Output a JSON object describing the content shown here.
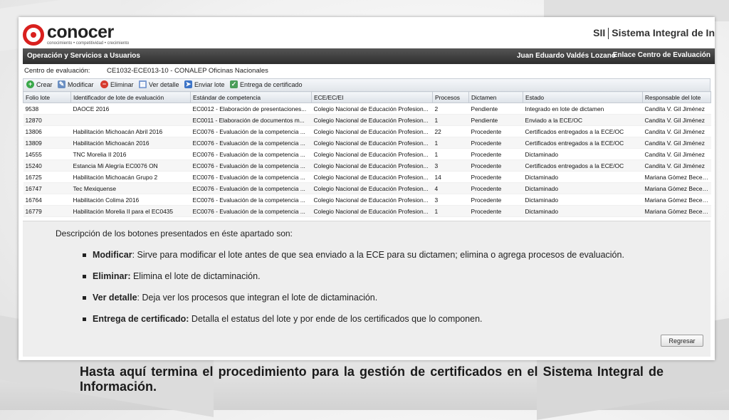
{
  "brand": {
    "name": "conocer",
    "tagline": "conocimiento • competitividad • crecimiento",
    "logo_colors": {
      "primary": "#d9201e"
    }
  },
  "system": {
    "abbr": "SII",
    "name": "Sistema Integral de In"
  },
  "topbar": {
    "section": "Operación y Servicios a Usuarios",
    "user": "Juan Eduardo Valdés Lozano",
    "link": "Enlace Centro de Evaluación"
  },
  "context": {
    "label": "Centro de evaluación:",
    "value": "CE1032-ECE013-10 - CONALEP Oficinas Nacionales"
  },
  "toolbar": {
    "crear": "Crear",
    "modificar": "Modificar",
    "eliminar": "Eliminar",
    "ver_detalle": "Ver detalle",
    "enviar_lote": "Enviar lote",
    "entrega": "Entrega de certificado"
  },
  "table": {
    "headers": [
      "Folio lote",
      "Identificador de lote de evaluación",
      "Estándar de competencia",
      "ECE/EC/EI",
      "Procesos",
      "Dictamen",
      "Estado",
      "Responsable del lote"
    ],
    "rows": [
      [
        "9538",
        "DAOCE 2016",
        "EC0012 - Elaboración de presentaciones...",
        "Colegio Nacional de Educación Profesion...",
        "2",
        "Pendiente",
        "Integrado en lote de dictamen",
        "Candita V. Gil Jiménez"
      ],
      [
        "12870",
        "",
        "EC0011 - Elaboración de documentos m...",
        "Colegio Nacional de Educación Profesion...",
        "1",
        "Pendiente",
        "Enviado a la ECE/OC",
        "Candita V. Gil Jiménez"
      ],
      [
        "13806",
        "Habilitación Michoacán Abril 2016",
        "EC0076 - Evaluación de la competencia ...",
        "Colegio Nacional de Educación Profesion...",
        "22",
        "Procedente",
        "Certificados entregados a la ECE/OC",
        "Candita V. Gil Jiménez"
      ],
      [
        "13809",
        "Habilitación Michoacán 2016",
        "EC0076 - Evaluación de la competencia ...",
        "Colegio Nacional de Educación Profesion...",
        "1",
        "Procedente",
        "Certificados entregados a la ECE/OC",
        "Candita V. Gil Jiménez"
      ],
      [
        "14555",
        "TNC Morelia II 2016",
        "EC0076 - Evaluación de la competencia ...",
        "Colegio Nacional de Educación Profesion...",
        "1",
        "Procedente",
        "Dictaminado",
        "Candita V. Gil Jiménez"
      ],
      [
        "15240",
        "Estancia Mi Alegría EC0076 ON",
        "EC0076 - Evaluación de la competencia ...",
        "Colegio Nacional de Educación Profesion...",
        "3",
        "Procedente",
        "Certificados entregados a la ECE/OC",
        "Candita V. Gil Jiménez"
      ],
      [
        "16725",
        "Habilitación Michoacán Grupo 2",
        "EC0076 - Evaluación de la competencia ...",
        "Colegio Nacional de Educación Profesion...",
        "14",
        "Procedente",
        "Dictaminado",
        "Mariana Gómez Becerra"
      ],
      [
        "16747",
        "Tec Mexiquense",
        "EC0076 - Evaluación de la competencia ...",
        "Colegio Nacional de Educación Profesion...",
        "4",
        "Procedente",
        "Dictaminado",
        "Mariana Gómez Becerra"
      ],
      [
        "16764",
        "Habilitación Colima 2016",
        "EC0076 - Evaluación de la competencia ...",
        "Colegio Nacional de Educación Profesion...",
        "3",
        "Procedente",
        "Dictaminado",
        "Mariana Gómez Becerra"
      ],
      [
        "16779",
        "Habilitación Morelia II para el EC0435",
        "EC0076 - Evaluación de la competencia ...",
        "Colegio Nacional de Educación Profesion...",
        "1",
        "Procedente",
        "Dictaminado",
        "Mariana Gómez Becerra"
      ]
    ]
  },
  "description": {
    "intro": "Descripción de los botones presentados en éste apartado son:",
    "items": [
      {
        "term": "Modificar",
        "text": ": Sirve para modificar el lote antes de que sea enviado a la ECE para su dictamen; elimina o agrega procesos de evaluación."
      },
      {
        "term": "Eliminar:",
        "text": " Elimina el lote de dictaminación."
      },
      {
        "term": "Ver detalle",
        "text": ": Deja ver los procesos que integran el lote de dictaminación."
      },
      {
        "term": "Entrega de certificado:",
        "text": " Detalla el estatus del lote y por ende de los certificados que lo componen."
      }
    ]
  },
  "regresar": "Regresar",
  "caption": "Hasta aquí termina el procedimiento para la gestión de certificados en el Sistema Integral de Información."
}
